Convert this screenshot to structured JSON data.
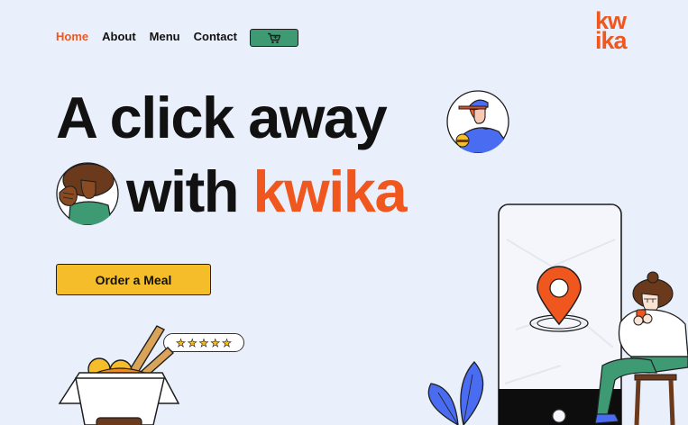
{
  "nav": {
    "items": [
      {
        "label": "Home",
        "active": true
      },
      {
        "label": "About",
        "active": false
      },
      {
        "label": "Menu",
        "active": false
      },
      {
        "label": "Contact",
        "active": false
      }
    ],
    "cart_icon": "shopping-cart-icon"
  },
  "logo": {
    "line1": "kw",
    "line2": "ika"
  },
  "hero": {
    "line1": "A click away",
    "line2_prefix": "with ",
    "line2_brand": "kwika"
  },
  "cta": {
    "label": "Order a Meal"
  },
  "rating": {
    "stars": 5,
    "max": 5
  },
  "colors": {
    "background": "#e9effb",
    "accent": "#f0571e",
    "cta": "#f6bd2a",
    "cart": "#3e9a73"
  }
}
